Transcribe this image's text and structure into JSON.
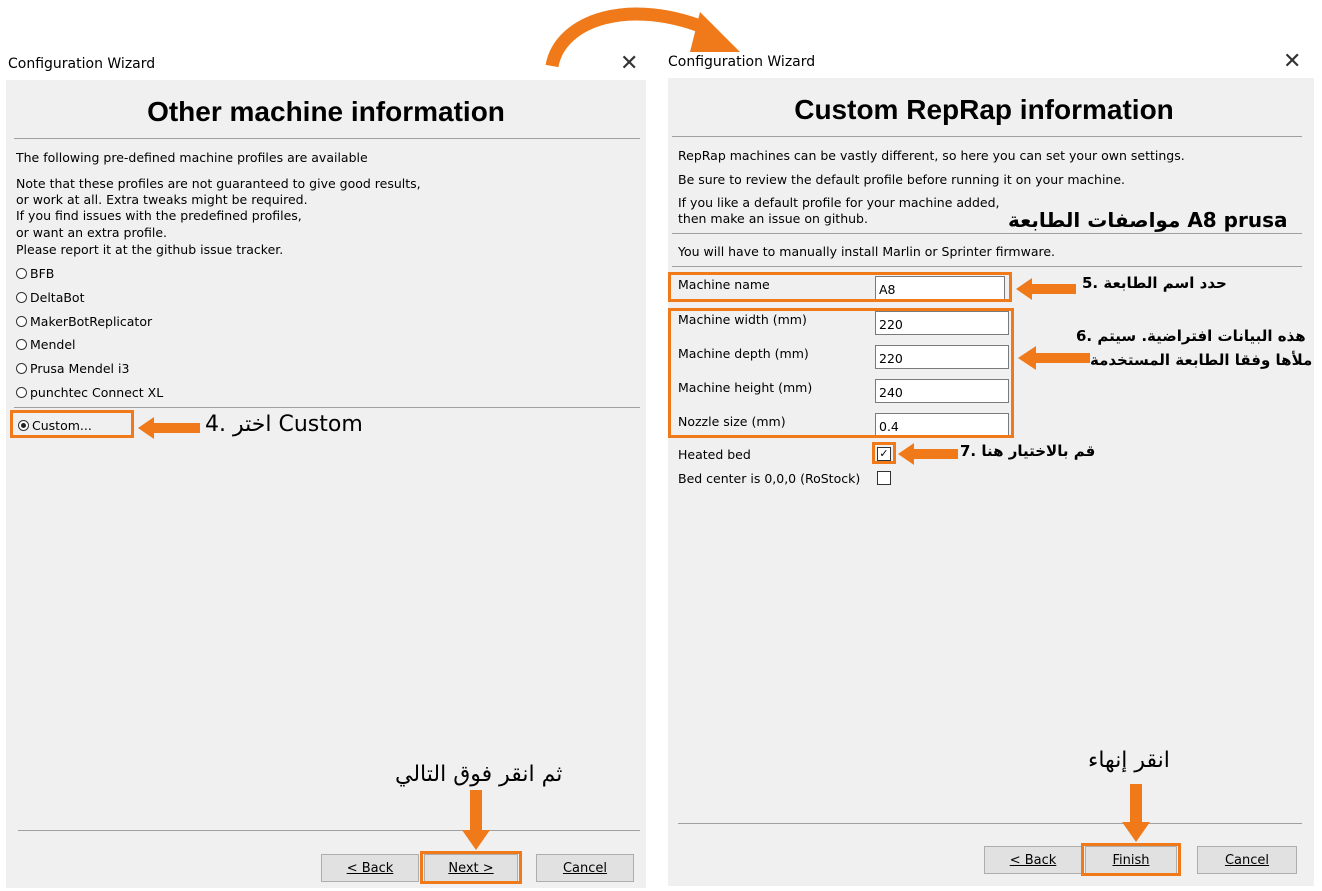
{
  "left_window": {
    "title": "Configuration Wizard",
    "close_glyph": "✕",
    "heading": "Other machine information",
    "intro": "The following pre-defined machine profiles are available",
    "note_lines": [
      "Note that these profiles are not guaranteed to give good results,",
      "or work at all. Extra tweaks might be required.",
      "If you find issues with the predefined profiles,",
      "or want an extra profile.",
      "Please report it at the github issue tracker."
    ],
    "profiles": [
      "BFB",
      "DeltaBot",
      "MakerBotReplicator",
      "Mendel",
      "Prusa Mendel i3",
      "punchtec Connect XL"
    ],
    "custom_option": "Custom...",
    "buttons": {
      "back": "< Back",
      "next": "Next >",
      "cancel": "Cancel"
    }
  },
  "right_window": {
    "title": "Configuration Wizard",
    "close_glyph": "✕",
    "heading": "Custom RepRap information",
    "intro_lines": [
      "RepRap machines can be vastly different, so here you can set your own settings.",
      "Be sure to review the default profile before running it on your machine.",
      "If you like a default profile for your machine added,",
      "then make an issue on github."
    ],
    "firmware_note": "You will have to manually install Marlin or Sprinter firmware.",
    "fields": [
      {
        "label": "Machine name",
        "value": "A8"
      },
      {
        "label": "Machine width (mm)",
        "value": "220"
      },
      {
        "label": "Machine depth (mm)",
        "value": "220"
      },
      {
        "label": "Machine height (mm)",
        "value": "240"
      },
      {
        "label": "Nozzle size (mm)",
        "value": "0.4"
      }
    ],
    "heated_bed": {
      "label": "Heated bed",
      "checked": true
    },
    "bed_center": {
      "label": "Bed center is 0,0,0 (RoStock)",
      "checked": false
    },
    "buttons": {
      "back": "< Back",
      "finish": "Finish",
      "cancel": "Cancel"
    }
  },
  "annotations": {
    "choose_custom": "4. اختر Custom",
    "then_next": "ثم انقر فوق التالي",
    "printer_specs": "مواصفات الطابعة A8 prusa",
    "set_name": "5. حدد اسم الطابعة",
    "defaults_line1": "6. هذه البيانات افتراضية. سيتم",
    "defaults_line2": "ملأها وفقا الطابعة المستخدمة",
    "check_here": "7. قم بالاختيار هنا",
    "click_finish": "انقر إنهاء"
  },
  "colors": {
    "highlight": "#f07a1a",
    "window_bg": "#f0f0f0"
  },
  "icons": [
    "close-icon",
    "arrow-left-icon",
    "arrow-down-icon",
    "curved-arrow-icon",
    "checkmark-icon"
  ]
}
